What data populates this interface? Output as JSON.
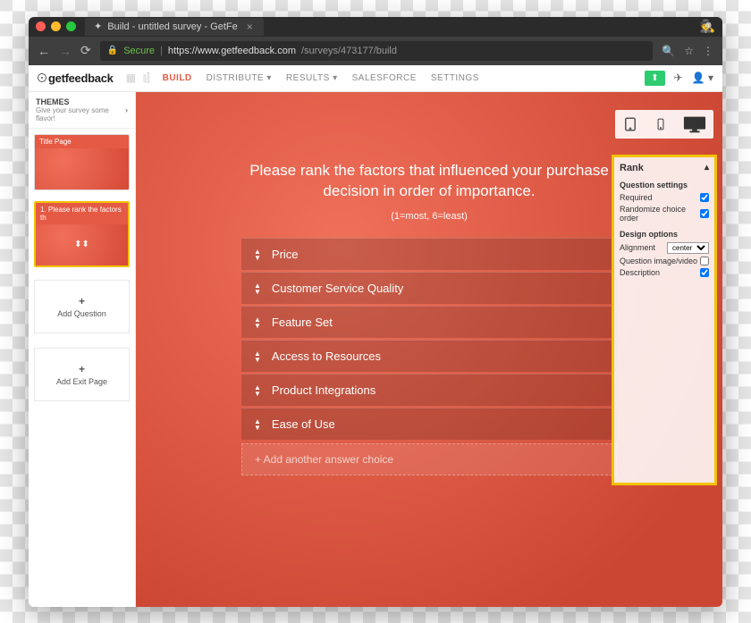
{
  "browser": {
    "tab_title": "Build - untitled survey - GetFe",
    "secure_label": "Secure",
    "url_host": "https://www.getfeedback.com",
    "url_path": "/surveys/473177/build"
  },
  "header": {
    "logo": "getfeedback",
    "tabs": {
      "build": "BUILD",
      "distribute": "DISTRIBUTE",
      "results": "RESULTS",
      "salesforce": "SALESFORCE",
      "settings": "SETTINGS"
    }
  },
  "sidebar": {
    "themes_label": "THEMES",
    "themes_sub": "Give your survey some flavor!",
    "thumbs": [
      {
        "label": "Title Page"
      },
      {
        "label": "1. Please rank the factors th"
      }
    ],
    "add_question": "Add Question",
    "add_exit": "Add Exit Page"
  },
  "canvas": {
    "prompt": "Please rank the factors that influenced your purchase decision in order of importance.",
    "hint": "(1=most, 6=least)",
    "options": [
      "Price",
      "Customer Service Quality",
      "Feature Set",
      "Access to Resources",
      "Product Integrations",
      "Ease of Use"
    ],
    "add_choice": "+  Add another answer choice"
  },
  "panel": {
    "title": "Rank",
    "section_question": "Question settings",
    "required": "Required",
    "randomize": "Randomize choice order",
    "section_design": "Design options",
    "alignment": "Alignment",
    "alignment_value": "center",
    "imgvid": "Question image/video",
    "description": "Description",
    "checks": {
      "required": true,
      "randomize": true,
      "imgvid": false,
      "description": true
    }
  }
}
